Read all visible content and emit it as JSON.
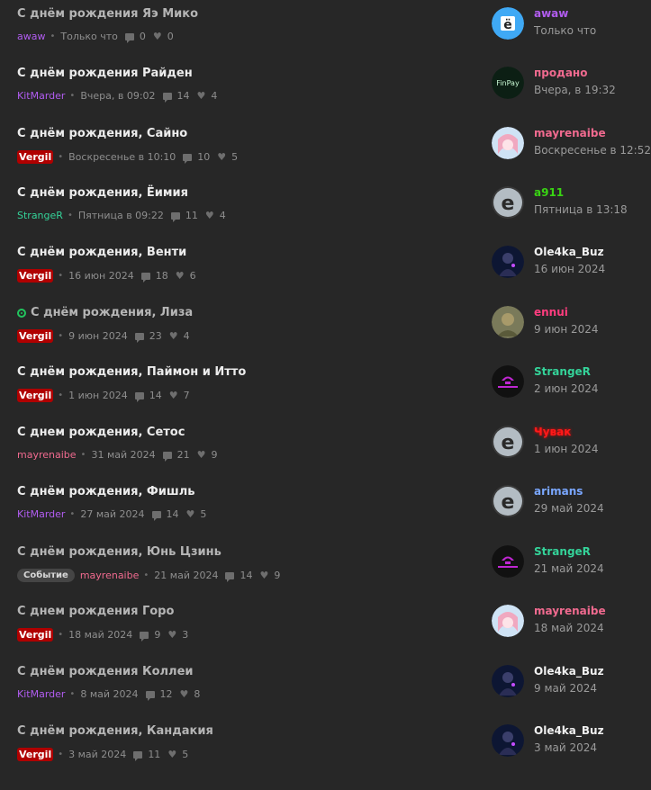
{
  "threads": [
    {
      "title": "С днём рождения Яэ Мико",
      "title_style": "read",
      "author": "awaw",
      "author_style": "purple",
      "date": "Только что",
      "replies": "0",
      "likes": "0",
      "last_user": "awaw",
      "last_user_style": "purple",
      "last_date": "Только что",
      "avatar": "e-blue"
    },
    {
      "title": "С днём рождения Райден",
      "title_style": "unread",
      "author": "KitMarder",
      "author_style": "purple",
      "date": "Вчера, в 09:02",
      "replies": "14",
      "likes": "4",
      "last_user": "продано",
      "last_user_style": "pink",
      "last_date": "Вчера, в 19:32",
      "avatar": "finpay"
    },
    {
      "title": "С днём рождения, Сайно",
      "title_style": "unread",
      "author": "Vergil",
      "author_style": "badge",
      "date": "Воскресенье в 10:10",
      "replies": "10",
      "likes": "5",
      "last_user": "mayrenaibe",
      "last_user_style": "pink",
      "last_date": "Воскресенье в 12:52",
      "avatar": "anime"
    },
    {
      "title": "С днём рождения, Ёимия",
      "title_style": "unread",
      "author": "StrangeR",
      "author_style": "green",
      "date": "Пятница в 09:22",
      "replies": "11",
      "likes": "4",
      "last_user": "a911",
      "last_user_style": "lime",
      "last_date": "Пятница в 13:18",
      "avatar": "e-grey"
    },
    {
      "title": "С днём рождения, Венти",
      "title_style": "unread",
      "author": "Vergil",
      "author_style": "badge",
      "date": "16 июн 2024",
      "replies": "18",
      "likes": "6",
      "last_user": "Ole4ka_Buz",
      "last_user_style": "white",
      "last_date": "16 июн 2024",
      "avatar": "dark"
    },
    {
      "title": "С днём рождения, Лиза",
      "title_style": "read",
      "icon": "target-icon",
      "author": "Vergil",
      "author_style": "badge",
      "date": "9 июн 2024",
      "replies": "23",
      "likes": "4",
      "last_user": "ennui",
      "last_user_style": "hotpink",
      "last_date": "9 июн 2024",
      "avatar": "camo"
    },
    {
      "title": "С днём рождения, Паймон и Итто",
      "title_style": "unread",
      "author": "Vergil",
      "author_style": "badge",
      "date": "1 июн 2024",
      "replies": "14",
      "likes": "7",
      "last_user": "StrangeR",
      "last_user_style": "green",
      "last_date": "2 июн 2024",
      "avatar": "purple"
    },
    {
      "title": "С днем рождения, Сетос",
      "title_style": "unread",
      "author": "mayrenaibe",
      "author_style": "pink",
      "date": "31 май 2024",
      "replies": "21",
      "likes": "9",
      "last_user": "Чувак",
      "last_user_style": "chuvak",
      "last_date": "1 июн 2024",
      "avatar": "e-grey"
    },
    {
      "title": "С днём рождения, Фишль",
      "title_style": "unread",
      "author": "KitMarder",
      "author_style": "purple",
      "date": "27 май 2024",
      "replies": "14",
      "likes": "5",
      "last_user": "arimans",
      "last_user_style": "blue",
      "last_date": "29 май 2024",
      "avatar": "e-grey"
    },
    {
      "title": "С днём рождения, Юнь Цзинь",
      "title_style": "read",
      "author": "mayrenaibe",
      "author_style": "pink",
      "prefix": "Событие",
      "date": "21 май 2024",
      "replies": "14",
      "likes": "9",
      "last_user": "StrangeR",
      "last_user_style": "green",
      "last_date": "21 май 2024",
      "avatar": "purple"
    },
    {
      "title": "С днем рождения Горо",
      "title_style": "read",
      "author": "Vergil",
      "author_style": "badge",
      "date": "18 май 2024",
      "replies": "9",
      "likes": "3",
      "last_user": "mayrenaibe",
      "last_user_style": "pink",
      "last_date": "18 май 2024",
      "avatar": "anime"
    },
    {
      "title": "С днём рождения Коллеи",
      "title_style": "read",
      "author": "KitMarder",
      "author_style": "purple",
      "date": "8 май 2024",
      "replies": "12",
      "likes": "8",
      "last_user": "Ole4ka_Buz",
      "last_user_style": "white",
      "last_date": "9 май 2024",
      "avatar": "dark"
    },
    {
      "title": "С днём рождения, Кандакия",
      "title_style": "read",
      "author": "Vergil",
      "author_style": "badge",
      "date": "3 май 2024",
      "replies": "11",
      "likes": "5",
      "last_user": "Ole4ka_Buz",
      "last_user_style": "white",
      "last_date": "3 май 2024",
      "avatar": "dark"
    }
  ],
  "colors": {
    "background": "#272727",
    "badge_red": "#b00000",
    "accent_purple": "#b15cf0",
    "accent_green": "#34d399"
  }
}
